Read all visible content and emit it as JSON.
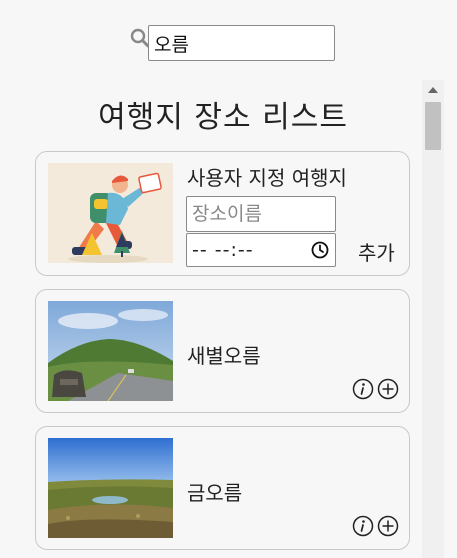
{
  "search": {
    "value": "오름",
    "icon": "search-icon"
  },
  "list": {
    "title": "여행지 장소 리스트",
    "custom_card": {
      "title": "사용자 지정 여행지",
      "name_placeholder": "장소이름",
      "time_value": "-- --:--",
      "add_label": "추가",
      "image": "hiker-illustration"
    },
    "places": [
      {
        "name": "새별오름",
        "image": "green-hill-with-stone-sign"
      },
      {
        "name": "금오름",
        "image": "grassland-crater-pond"
      }
    ]
  },
  "colors": {
    "background": "#f7f7f7",
    "card_border": "#c9c9c9",
    "scroll_thumb": "#c1c1c1"
  }
}
